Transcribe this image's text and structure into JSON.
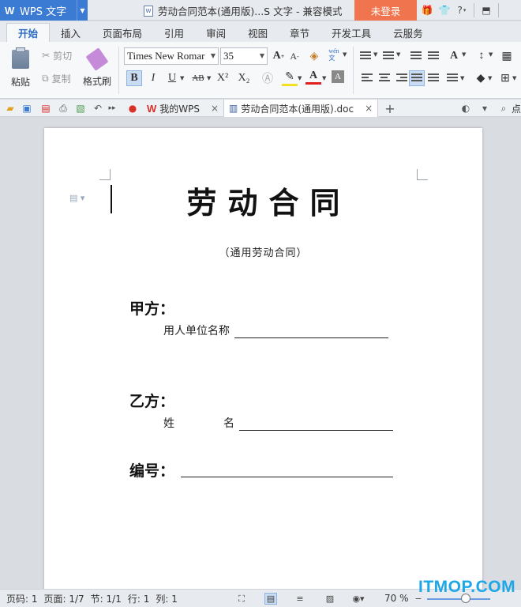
{
  "titlebar": {
    "app_name": "WPS 文字",
    "doc_title": "劳动合同范本(通用版)...S 文字 - 兼容模式",
    "login_label": "未登录",
    "icons": [
      "gift-icon",
      "shirt-icon",
      "help-icon",
      "restore-window-icon"
    ]
  },
  "ribbon_tabs": [
    "开始",
    "插入",
    "页面布局",
    "引用",
    "审阅",
    "视图",
    "章节",
    "开发工具",
    "云服务"
  ],
  "ribbon": {
    "paste_label": "粘贴",
    "cut_label": "剪切",
    "copy_label": "复制",
    "format_painter_label": "格式刷",
    "font_name": "Times New Romar",
    "font_size": "35",
    "wen_label": "wén\n文",
    "bold": "B",
    "italic": "I",
    "underline": "U",
    "strikethrough": "AB",
    "superscript": "X²",
    "subscript": "X₂",
    "font_color_label": "A",
    "shading_label": "A"
  },
  "qabar": {
    "doc_tabs": [
      {
        "label": "我的WPS"
      },
      {
        "label": "劳动合同范本(通用版).doc"
      }
    ],
    "right_label": "点"
  },
  "document": {
    "title": "劳动合同",
    "subtitle": "（通用劳动合同）",
    "party_a_label": "甲方：",
    "party_a_field": "用人单位名称",
    "party_b_label": "乙方：",
    "party_b_field_1": "姓",
    "party_b_field_2": "名",
    "number_label": "编号："
  },
  "statusbar": {
    "page_no": "页码: 1",
    "pages": "页面: 1/7",
    "section": "节: 1/1",
    "row": "行: 1",
    "col": "列: 1",
    "zoom": "70 %"
  },
  "watermark": "ITMOP.COM",
  "colors": {
    "accent_blue": "#3b7bd4",
    "login_orange": "#f0754e",
    "watermark": "#1ca7e8"
  }
}
